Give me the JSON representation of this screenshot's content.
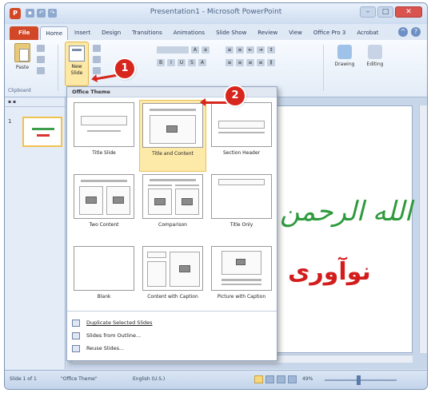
{
  "window": {
    "title": "Presentation1 - Microsoft PowerPoint",
    "app_icon": "P"
  },
  "ribbon": {
    "tabs": [
      "File",
      "Home",
      "Insert",
      "Design",
      "Transitions",
      "Animations",
      "Slide Show",
      "Review",
      "View",
      "Office Pro 3",
      "Acrobat"
    ],
    "active_tab": "Home",
    "paste_label": "Paste",
    "clipboard_label": "Clipboard",
    "new_slide_label": "New Slide",
    "drawing_label": "Drawing",
    "editing_label": "Editing"
  },
  "callouts": {
    "step1": "1",
    "step2": "2"
  },
  "layout_menu": {
    "header": "Office Theme",
    "layouts": [
      {
        "name": "Title Slide",
        "selected": false
      },
      {
        "name": "Title and Content",
        "selected": true
      },
      {
        "name": "Section Header",
        "selected": false
      },
      {
        "name": "Two Content",
        "selected": false
      },
      {
        "name": "Comparison",
        "selected": false
      },
      {
        "name": "Title Only",
        "selected": false
      },
      {
        "name": "Blank",
        "selected": false
      },
      {
        "name": "Content with Caption",
        "selected": false
      },
      {
        "name": "Picture with Caption",
        "selected": false
      }
    ],
    "actions": [
      {
        "label": "Duplicate Selected Slides"
      },
      {
        "label": "Slides from Outline..."
      },
      {
        "label": "Reuse Slides..."
      }
    ]
  },
  "slides_panel": {
    "slide_number": "1"
  },
  "slide": {
    "arabic_line1": "بسم الله الرحمن",
    "arabic_line2": "نوآوری"
  },
  "statusbar": {
    "slide_info": "Slide 1 of 1",
    "theme": "\"Office Theme\"",
    "language": "English (U.S.)",
    "zoom": "49%"
  }
}
